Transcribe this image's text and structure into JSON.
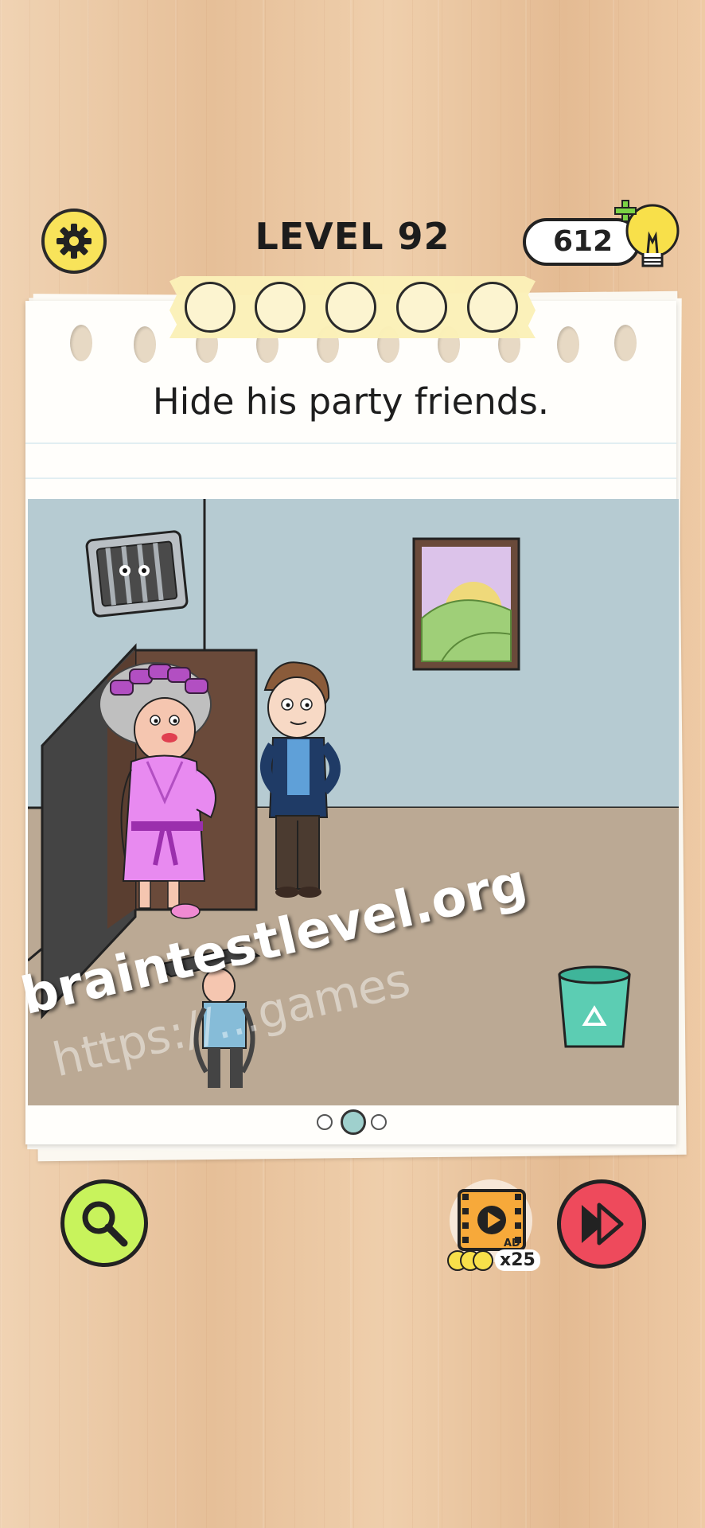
{
  "header": {
    "level_label": "LEVEL 92",
    "hint_count": "612"
  },
  "answer_slots": 5,
  "question": "Hide his party friends.",
  "pagination": {
    "total": 3,
    "active": 1
  },
  "watermark": {
    "main": "braintestlevel.org",
    "faint": "https://...games"
  },
  "ad_button": {
    "badge": "AD",
    "reward": "x25"
  },
  "colors": {
    "settings": "#f8e35a",
    "search": "#c8f35c",
    "skip": "#ee4a5c",
    "tape": "#fbf1b8",
    "wall": "#b6cbd2",
    "floor": "#bba994",
    "robe": "#e88af0"
  },
  "icons": [
    "gear-icon",
    "lightbulb-icon",
    "plus-icon",
    "magnifier-icon",
    "skip-icon",
    "video-ad-icon",
    "recycle-icon"
  ]
}
